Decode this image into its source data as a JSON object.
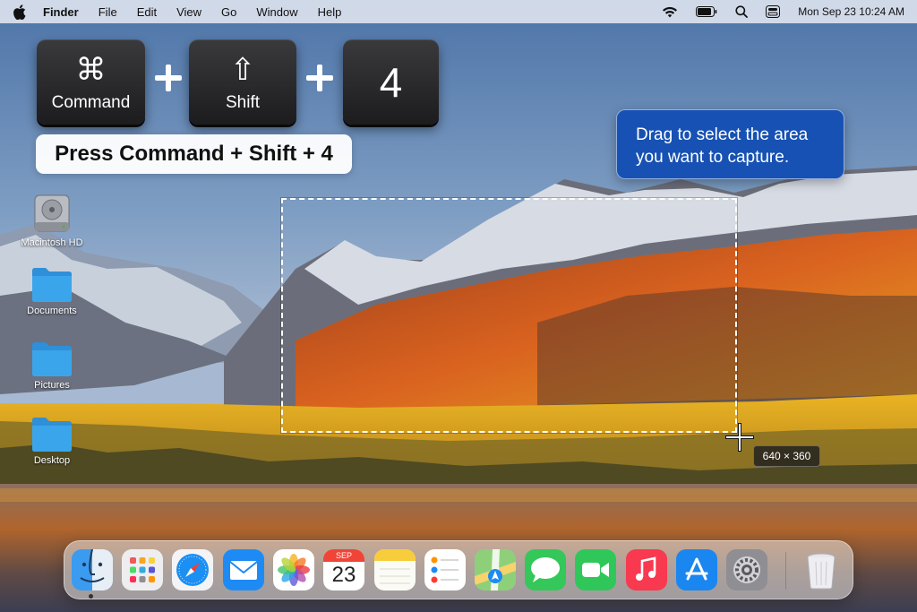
{
  "menubar": {
    "app_name": "Finder",
    "menus": [
      "File",
      "Edit",
      "View",
      "Go",
      "Window",
      "Help"
    ],
    "clock": "Mon Sep 23  10:24 AM",
    "status_icons": [
      "wifi-icon",
      "battery-icon",
      "search-icon",
      "control-center-icon"
    ]
  },
  "shortcut": {
    "keys": [
      {
        "glyph": "⌘",
        "label": "Command"
      },
      {
        "glyph": "⇧",
        "label": "Shift"
      },
      {
        "glyph": "",
        "label": "4"
      }
    ],
    "plus": "+",
    "instruction": "Press Command + Shift + 4"
  },
  "tooltip": {
    "line1": "Drag to select the area",
    "line2": "you want to capture."
  },
  "desktop_icons": [
    {
      "label": "Macintosh HD",
      "icon": "hard-drive-icon"
    },
    {
      "label": "Documents",
      "icon": "folder-icon"
    },
    {
      "label": "Pictures",
      "icon": "folder-icon"
    },
    {
      "label": "Desktop",
      "icon": "folder-icon"
    }
  ],
  "selection": {
    "dimensions": "640 × 360"
  },
  "dock": {
    "apps": [
      "Finder",
      "Launchpad",
      "Safari",
      "Mail",
      "Photos",
      "Calendar",
      "Notes",
      "Reminders",
      "Maps",
      "Messages",
      "FaceTime",
      "Music",
      "App Store",
      "System Settings",
      "Trash"
    ],
    "calendar_month": "SEP",
    "calendar_day": "23"
  },
  "colors": {
    "tooltip_bg": "#1751b3",
    "folder_blue": "#3ba5ec",
    "key_bg": "#2a2a2c"
  }
}
